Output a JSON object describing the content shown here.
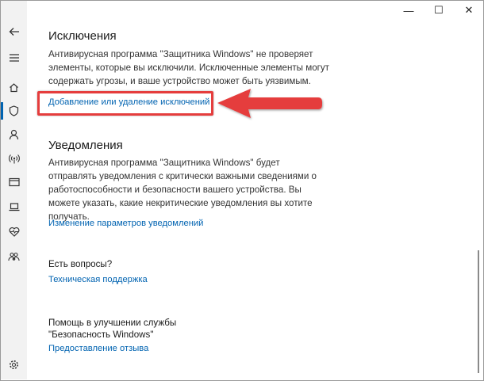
{
  "window": {
    "minimize_glyph": "—",
    "maximize_glyph": "☐",
    "close_glyph": "✕"
  },
  "sidebar": {
    "items": [
      {
        "icon": "back-arrow-icon"
      },
      {
        "icon": "hamburger-menu-icon"
      },
      {
        "icon": "home-icon"
      },
      {
        "icon": "shield-icon",
        "active": true
      },
      {
        "icon": "person-icon"
      },
      {
        "icon": "wireless-icon"
      },
      {
        "icon": "browser-window-icon"
      },
      {
        "icon": "laptop-icon"
      },
      {
        "icon": "heart-pulse-icon"
      },
      {
        "icon": "family-icon"
      },
      {
        "icon": "gear-icon"
      }
    ]
  },
  "exclusions": {
    "title": "Исключения",
    "description": "Антивирусная программа \"Защитника Windows\" не проверяет элементы, которые вы исключили. Исключенные элементы могут содержать угрозы, и ваше устройство может быть уязвимым.",
    "link": "Добавление или удаление исключений"
  },
  "notifications": {
    "title": "Уведомления",
    "description": "Антивирусная программа \"Защитника Windows\" будет отправлять уведомления с критически важными сведениями о работоспособности и безопасности вашего устройства. Вы можете указать, какие некритические уведомления вы хотите получать.",
    "link": "Изменение параметров уведомлений"
  },
  "questions": {
    "title": "Есть вопросы?",
    "link": "Техническая поддержка"
  },
  "improve": {
    "line1": "Помощь в улучшении службы",
    "line2": "\"Безопасность Windows\"",
    "link": "Предоставление отзыва"
  },
  "colors": {
    "accent": "#0063b1",
    "annotation": "#e53d3d"
  }
}
